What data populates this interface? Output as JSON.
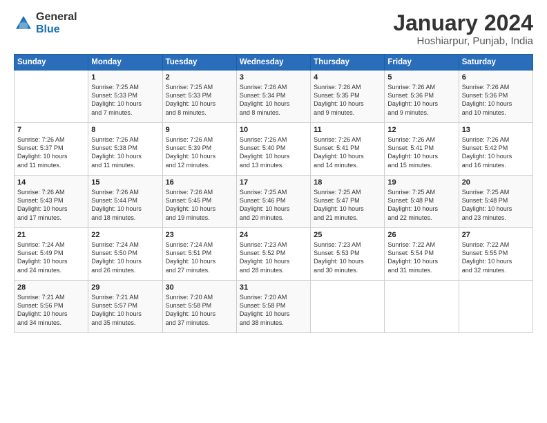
{
  "logo": {
    "general": "General",
    "blue": "Blue"
  },
  "title": "January 2024",
  "subtitle": "Hoshiarpur, Punjab, India",
  "headers": [
    "Sunday",
    "Monday",
    "Tuesday",
    "Wednesday",
    "Thursday",
    "Friday",
    "Saturday"
  ],
  "weeks": [
    [
      {
        "day": "",
        "info": ""
      },
      {
        "day": "1",
        "info": "Sunrise: 7:25 AM\nSunset: 5:33 PM\nDaylight: 10 hours\nand 7 minutes."
      },
      {
        "day": "2",
        "info": "Sunrise: 7:25 AM\nSunset: 5:33 PM\nDaylight: 10 hours\nand 8 minutes."
      },
      {
        "day": "3",
        "info": "Sunrise: 7:26 AM\nSunset: 5:34 PM\nDaylight: 10 hours\nand 8 minutes."
      },
      {
        "day": "4",
        "info": "Sunrise: 7:26 AM\nSunset: 5:35 PM\nDaylight: 10 hours\nand 9 minutes."
      },
      {
        "day": "5",
        "info": "Sunrise: 7:26 AM\nSunset: 5:36 PM\nDaylight: 10 hours\nand 9 minutes."
      },
      {
        "day": "6",
        "info": "Sunrise: 7:26 AM\nSunset: 5:36 PM\nDaylight: 10 hours\nand 10 minutes."
      }
    ],
    [
      {
        "day": "7",
        "info": "Sunrise: 7:26 AM\nSunset: 5:37 PM\nDaylight: 10 hours\nand 11 minutes."
      },
      {
        "day": "8",
        "info": "Sunrise: 7:26 AM\nSunset: 5:38 PM\nDaylight: 10 hours\nand 11 minutes."
      },
      {
        "day": "9",
        "info": "Sunrise: 7:26 AM\nSunset: 5:39 PM\nDaylight: 10 hours\nand 12 minutes."
      },
      {
        "day": "10",
        "info": "Sunrise: 7:26 AM\nSunset: 5:40 PM\nDaylight: 10 hours\nand 13 minutes."
      },
      {
        "day": "11",
        "info": "Sunrise: 7:26 AM\nSunset: 5:41 PM\nDaylight: 10 hours\nand 14 minutes."
      },
      {
        "day": "12",
        "info": "Sunrise: 7:26 AM\nSunset: 5:41 PM\nDaylight: 10 hours\nand 15 minutes."
      },
      {
        "day": "13",
        "info": "Sunrise: 7:26 AM\nSunset: 5:42 PM\nDaylight: 10 hours\nand 16 minutes."
      }
    ],
    [
      {
        "day": "14",
        "info": "Sunrise: 7:26 AM\nSunset: 5:43 PM\nDaylight: 10 hours\nand 17 minutes."
      },
      {
        "day": "15",
        "info": "Sunrise: 7:26 AM\nSunset: 5:44 PM\nDaylight: 10 hours\nand 18 minutes."
      },
      {
        "day": "16",
        "info": "Sunrise: 7:26 AM\nSunset: 5:45 PM\nDaylight: 10 hours\nand 19 minutes."
      },
      {
        "day": "17",
        "info": "Sunrise: 7:25 AM\nSunset: 5:46 PM\nDaylight: 10 hours\nand 20 minutes."
      },
      {
        "day": "18",
        "info": "Sunrise: 7:25 AM\nSunset: 5:47 PM\nDaylight: 10 hours\nand 21 minutes."
      },
      {
        "day": "19",
        "info": "Sunrise: 7:25 AM\nSunset: 5:48 PM\nDaylight: 10 hours\nand 22 minutes."
      },
      {
        "day": "20",
        "info": "Sunrise: 7:25 AM\nSunset: 5:48 PM\nDaylight: 10 hours\nand 23 minutes."
      }
    ],
    [
      {
        "day": "21",
        "info": "Sunrise: 7:24 AM\nSunset: 5:49 PM\nDaylight: 10 hours\nand 24 minutes."
      },
      {
        "day": "22",
        "info": "Sunrise: 7:24 AM\nSunset: 5:50 PM\nDaylight: 10 hours\nand 26 minutes."
      },
      {
        "day": "23",
        "info": "Sunrise: 7:24 AM\nSunset: 5:51 PM\nDaylight: 10 hours\nand 27 minutes."
      },
      {
        "day": "24",
        "info": "Sunrise: 7:23 AM\nSunset: 5:52 PM\nDaylight: 10 hours\nand 28 minutes."
      },
      {
        "day": "25",
        "info": "Sunrise: 7:23 AM\nSunset: 5:53 PM\nDaylight: 10 hours\nand 30 minutes."
      },
      {
        "day": "26",
        "info": "Sunrise: 7:22 AM\nSunset: 5:54 PM\nDaylight: 10 hours\nand 31 minutes."
      },
      {
        "day": "27",
        "info": "Sunrise: 7:22 AM\nSunset: 5:55 PM\nDaylight: 10 hours\nand 32 minutes."
      }
    ],
    [
      {
        "day": "28",
        "info": "Sunrise: 7:21 AM\nSunset: 5:56 PM\nDaylight: 10 hours\nand 34 minutes."
      },
      {
        "day": "29",
        "info": "Sunrise: 7:21 AM\nSunset: 5:57 PM\nDaylight: 10 hours\nand 35 minutes."
      },
      {
        "day": "30",
        "info": "Sunrise: 7:20 AM\nSunset: 5:58 PM\nDaylight: 10 hours\nand 37 minutes."
      },
      {
        "day": "31",
        "info": "Sunrise: 7:20 AM\nSunset: 5:58 PM\nDaylight: 10 hours\nand 38 minutes."
      },
      {
        "day": "",
        "info": ""
      },
      {
        "day": "",
        "info": ""
      },
      {
        "day": "",
        "info": ""
      }
    ]
  ]
}
